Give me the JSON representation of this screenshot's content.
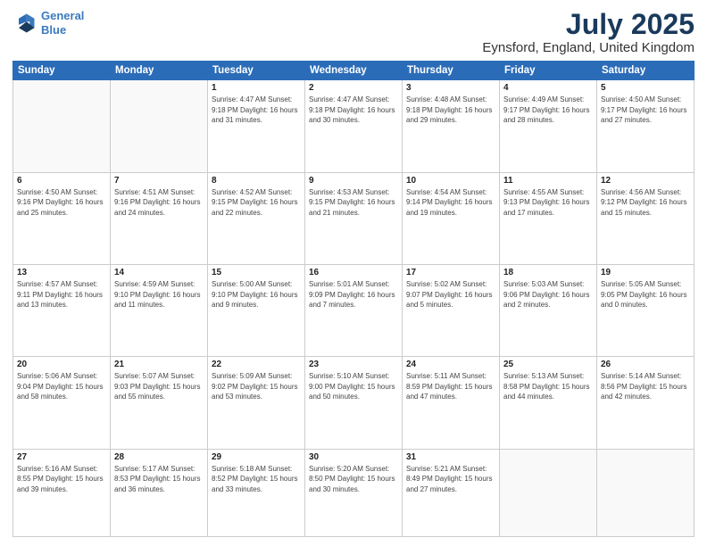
{
  "header": {
    "logo_line1": "General",
    "logo_line2": "Blue",
    "title": "July 2025",
    "subtitle": "Eynsford, England, United Kingdom"
  },
  "weekdays": [
    "Sunday",
    "Monday",
    "Tuesday",
    "Wednesday",
    "Thursday",
    "Friday",
    "Saturday"
  ],
  "weeks": [
    [
      {
        "day": "",
        "detail": ""
      },
      {
        "day": "",
        "detail": ""
      },
      {
        "day": "1",
        "detail": "Sunrise: 4:47 AM\nSunset: 9:18 PM\nDaylight: 16 hours\nand 31 minutes."
      },
      {
        "day": "2",
        "detail": "Sunrise: 4:47 AM\nSunset: 9:18 PM\nDaylight: 16 hours\nand 30 minutes."
      },
      {
        "day": "3",
        "detail": "Sunrise: 4:48 AM\nSunset: 9:18 PM\nDaylight: 16 hours\nand 29 minutes."
      },
      {
        "day": "4",
        "detail": "Sunrise: 4:49 AM\nSunset: 9:17 PM\nDaylight: 16 hours\nand 28 minutes."
      },
      {
        "day": "5",
        "detail": "Sunrise: 4:50 AM\nSunset: 9:17 PM\nDaylight: 16 hours\nand 27 minutes."
      }
    ],
    [
      {
        "day": "6",
        "detail": "Sunrise: 4:50 AM\nSunset: 9:16 PM\nDaylight: 16 hours\nand 25 minutes."
      },
      {
        "day": "7",
        "detail": "Sunrise: 4:51 AM\nSunset: 9:16 PM\nDaylight: 16 hours\nand 24 minutes."
      },
      {
        "day": "8",
        "detail": "Sunrise: 4:52 AM\nSunset: 9:15 PM\nDaylight: 16 hours\nand 22 minutes."
      },
      {
        "day": "9",
        "detail": "Sunrise: 4:53 AM\nSunset: 9:15 PM\nDaylight: 16 hours\nand 21 minutes."
      },
      {
        "day": "10",
        "detail": "Sunrise: 4:54 AM\nSunset: 9:14 PM\nDaylight: 16 hours\nand 19 minutes."
      },
      {
        "day": "11",
        "detail": "Sunrise: 4:55 AM\nSunset: 9:13 PM\nDaylight: 16 hours\nand 17 minutes."
      },
      {
        "day": "12",
        "detail": "Sunrise: 4:56 AM\nSunset: 9:12 PM\nDaylight: 16 hours\nand 15 minutes."
      }
    ],
    [
      {
        "day": "13",
        "detail": "Sunrise: 4:57 AM\nSunset: 9:11 PM\nDaylight: 16 hours\nand 13 minutes."
      },
      {
        "day": "14",
        "detail": "Sunrise: 4:59 AM\nSunset: 9:10 PM\nDaylight: 16 hours\nand 11 minutes."
      },
      {
        "day": "15",
        "detail": "Sunrise: 5:00 AM\nSunset: 9:10 PM\nDaylight: 16 hours\nand 9 minutes."
      },
      {
        "day": "16",
        "detail": "Sunrise: 5:01 AM\nSunset: 9:09 PM\nDaylight: 16 hours\nand 7 minutes."
      },
      {
        "day": "17",
        "detail": "Sunrise: 5:02 AM\nSunset: 9:07 PM\nDaylight: 16 hours\nand 5 minutes."
      },
      {
        "day": "18",
        "detail": "Sunrise: 5:03 AM\nSunset: 9:06 PM\nDaylight: 16 hours\nand 2 minutes."
      },
      {
        "day": "19",
        "detail": "Sunrise: 5:05 AM\nSunset: 9:05 PM\nDaylight: 16 hours\nand 0 minutes."
      }
    ],
    [
      {
        "day": "20",
        "detail": "Sunrise: 5:06 AM\nSunset: 9:04 PM\nDaylight: 15 hours\nand 58 minutes."
      },
      {
        "day": "21",
        "detail": "Sunrise: 5:07 AM\nSunset: 9:03 PM\nDaylight: 15 hours\nand 55 minutes."
      },
      {
        "day": "22",
        "detail": "Sunrise: 5:09 AM\nSunset: 9:02 PM\nDaylight: 15 hours\nand 53 minutes."
      },
      {
        "day": "23",
        "detail": "Sunrise: 5:10 AM\nSunset: 9:00 PM\nDaylight: 15 hours\nand 50 minutes."
      },
      {
        "day": "24",
        "detail": "Sunrise: 5:11 AM\nSunset: 8:59 PM\nDaylight: 15 hours\nand 47 minutes."
      },
      {
        "day": "25",
        "detail": "Sunrise: 5:13 AM\nSunset: 8:58 PM\nDaylight: 15 hours\nand 44 minutes."
      },
      {
        "day": "26",
        "detail": "Sunrise: 5:14 AM\nSunset: 8:56 PM\nDaylight: 15 hours\nand 42 minutes."
      }
    ],
    [
      {
        "day": "27",
        "detail": "Sunrise: 5:16 AM\nSunset: 8:55 PM\nDaylight: 15 hours\nand 39 minutes."
      },
      {
        "day": "28",
        "detail": "Sunrise: 5:17 AM\nSunset: 8:53 PM\nDaylight: 15 hours\nand 36 minutes."
      },
      {
        "day": "29",
        "detail": "Sunrise: 5:18 AM\nSunset: 8:52 PM\nDaylight: 15 hours\nand 33 minutes."
      },
      {
        "day": "30",
        "detail": "Sunrise: 5:20 AM\nSunset: 8:50 PM\nDaylight: 15 hours\nand 30 minutes."
      },
      {
        "day": "31",
        "detail": "Sunrise: 5:21 AM\nSunset: 8:49 PM\nDaylight: 15 hours\nand 27 minutes."
      },
      {
        "day": "",
        "detail": ""
      },
      {
        "day": "",
        "detail": ""
      }
    ]
  ]
}
